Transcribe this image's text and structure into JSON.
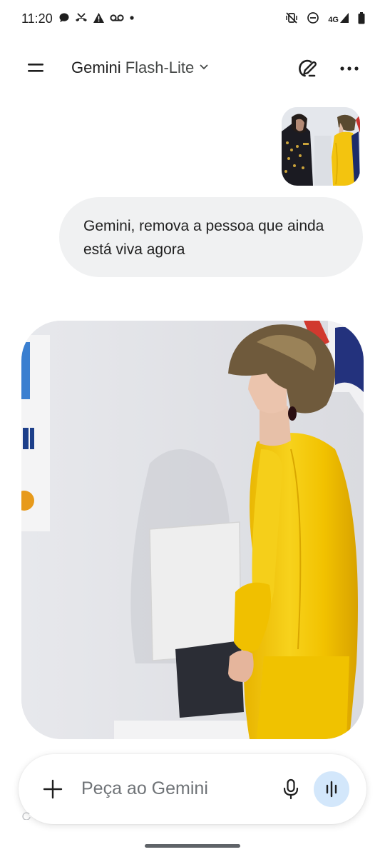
{
  "status_bar": {
    "time": "11:20",
    "network": "4G"
  },
  "header": {
    "app_name": "Gemini",
    "model_name": "Flash-Lite"
  },
  "conversation": {
    "user_message": "Gemini, remova a pessoa que ainda está viva agora"
  },
  "composer": {
    "placeholder": "Peça ao Gemini"
  },
  "icons": {
    "left_status": [
      "chat-bubble-icon",
      "missed-call-icon",
      "warning-icon",
      "voicemail-icon",
      "dot-icon"
    ],
    "right_status": [
      "vibrate-off-icon",
      "do-not-disturb-icon",
      "signal-icon",
      "battery-icon"
    ]
  },
  "colors": {
    "accent_live": "#d3e7fb",
    "bubble": "#f0f1f2",
    "dress_yellow": "#f2c200"
  }
}
